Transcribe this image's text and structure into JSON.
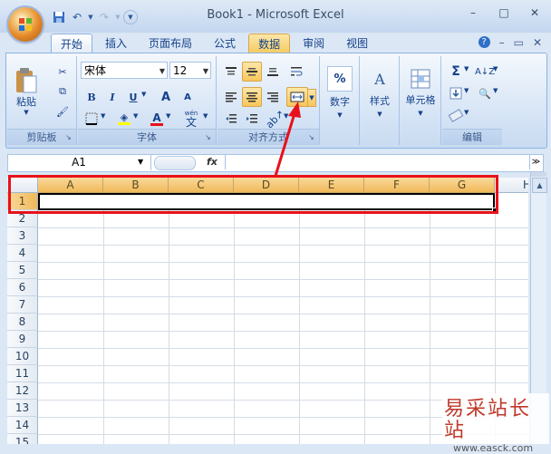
{
  "window": {
    "title": "Book1 - Microsoft Excel",
    "minimize": "–",
    "maximize": "□",
    "close": "✕"
  },
  "tabs": [
    {
      "label": "开始",
      "state": "active"
    },
    {
      "label": "插入",
      "state": ""
    },
    {
      "label": "页面布局",
      "state": ""
    },
    {
      "label": "公式",
      "state": ""
    },
    {
      "label": "数据",
      "state": "hover"
    },
    {
      "label": "审阅",
      "state": ""
    },
    {
      "label": "视图",
      "state": ""
    }
  ],
  "ribbon": {
    "clipboard": {
      "label": "剪贴板",
      "paste": "粘贴"
    },
    "font": {
      "label": "字体",
      "font_name": "宋体",
      "font_size": "12",
      "bold": "B",
      "italic": "I",
      "underline": "U",
      "grow": "A",
      "shrink": "A",
      "phonetic": "wén",
      "phonetic_char": "文"
    },
    "alignment": {
      "label": "对齐方式"
    },
    "number": {
      "label": "数字",
      "percent": "%"
    },
    "styles": {
      "label": "样式"
    },
    "cells": {
      "label": "单元格"
    },
    "editing": {
      "label": "编辑",
      "sum": "Σ"
    }
  },
  "formula_bar": {
    "name_box": "A1",
    "fx": "fx",
    "formula": ""
  },
  "sheet": {
    "columns": [
      "A",
      "B",
      "C",
      "D",
      "E",
      "F",
      "G",
      "H"
    ],
    "rows": [
      "1",
      "2",
      "3",
      "4",
      "5",
      "6",
      "7",
      "8",
      "9",
      "10",
      "11",
      "12",
      "13",
      "14",
      "15"
    ]
  },
  "colors": {
    "annotation": "#e8111b",
    "selected_header": "#f0b95a"
  },
  "watermark": {
    "line1": "易采站长站",
    "line2": "www.easck.com"
  }
}
